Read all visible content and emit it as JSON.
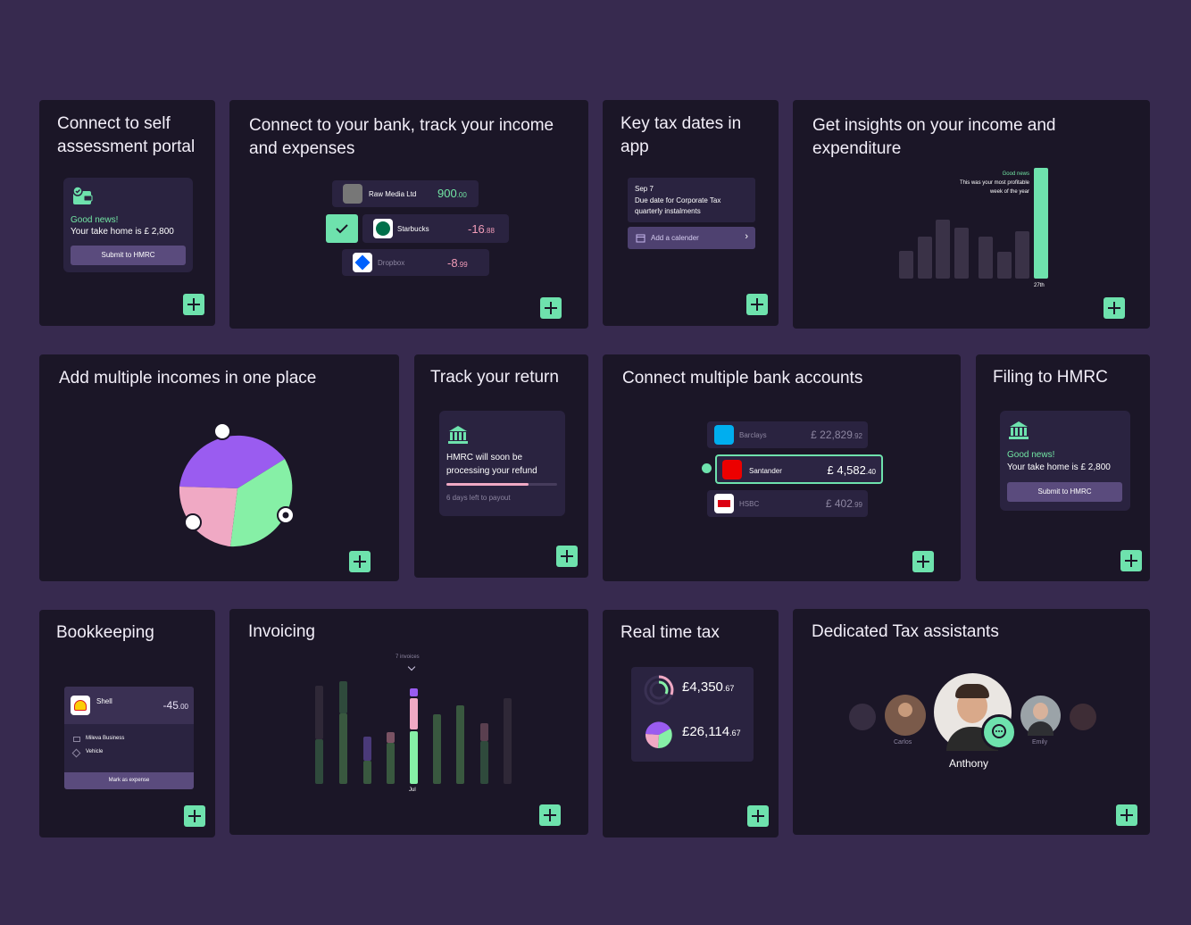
{
  "cards": {
    "self_assessment": {
      "title_line1": "Connect to self",
      "title_line2": "assessment portal",
      "good_news": "Good news!",
      "take_home": "Your take home is £ 2,800",
      "button": "Submit to HMRC"
    },
    "bank": {
      "title_line1": "Connect to your bank, track your income",
      "title_line2": "and expenses",
      "transactions": [
        {
          "name": "Raw Media Ltd",
          "amount": "900",
          "decimals": ".00"
        },
        {
          "name": "Starbucks",
          "amount": "-16",
          "decimals": ".88"
        },
        {
          "name": "Dropbox",
          "amount": "-8",
          "decimals": ".99"
        }
      ]
    },
    "tax_dates": {
      "title_line1": "Key tax dates in",
      "title_line2": "app",
      "date": "Sep 7",
      "desc_line1": "Due date for Corporate Tax",
      "desc_line2": "quarterly instalments",
      "calendar_button": "Add a calender",
      "chevron": "›"
    },
    "insights": {
      "title_line1": "Get insights on your income and",
      "title_line2": "expenditure",
      "good_news": "Good news",
      "note_line1": "This was your most profitable",
      "note_line2": "week of the year",
      "tick_labels": [
        "",
        "",
        "",
        "",
        "",
        "",
        "",
        "27th"
      ]
    },
    "multiple_incomes": {
      "title": "Add multiple incomes in one place"
    },
    "track_return": {
      "title": "Track your return",
      "line1": "HMRC will soon be",
      "line2": "processing your refund",
      "days_left": "6 days left to payout"
    },
    "multi_bank": {
      "title": "Connect multiple bank accounts",
      "accounts": [
        {
          "name": "Barclays",
          "amount": "£ 22,829",
          "decimals": ".92"
        },
        {
          "name": "Santander",
          "amount": "£ 4,582",
          "decimals": ".40"
        },
        {
          "name": "HSBC",
          "amount": "£ 402",
          "decimals": ".99"
        }
      ]
    },
    "filing": {
      "title": "Filing to HMRC",
      "good_news": "Good news!",
      "take_home": "Your take home is £ 2,800",
      "button": "Submit to HMRC"
    },
    "bookkeeping": {
      "title": "Bookkeeping",
      "merchant": "Shell",
      "merchant_sub": "",
      "amount": "-45",
      "decimals": ".00",
      "category": "Mileva Business",
      "subcategory": "Vehicle",
      "button": "Mark as expense"
    },
    "invoicing": {
      "title": "Invoicing",
      "tooltip": "7 invoices",
      "months": [
        "",
        "",
        "",
        "",
        "Jul",
        "",
        "",
        "",
        ""
      ]
    },
    "real_time_tax": {
      "title": "Real time tax",
      "tax_amount": "£4,350",
      "tax_decimals": ".67",
      "tax_sub": "",
      "income_amount": "£26,114",
      "income_decimals": ".67",
      "income_sub": ""
    },
    "assistants": {
      "title": "Dedicated Tax assistants",
      "names": [
        "",
        "Carlos",
        "Anthony",
        "Emily",
        ""
      ]
    }
  },
  "colors": {
    "background": "#372a4f",
    "card": "#1b1627",
    "accent_green": "#6ee2ad",
    "purple": "#9a5cf0",
    "pink": "#f0a9c4"
  },
  "icons": {
    "plus": "plus-icon",
    "check": "check-icon",
    "bank": "bank-building-icon",
    "calendar": "calendar-icon",
    "wallet": "wallet-icon",
    "chat": "chat-icon"
  }
}
